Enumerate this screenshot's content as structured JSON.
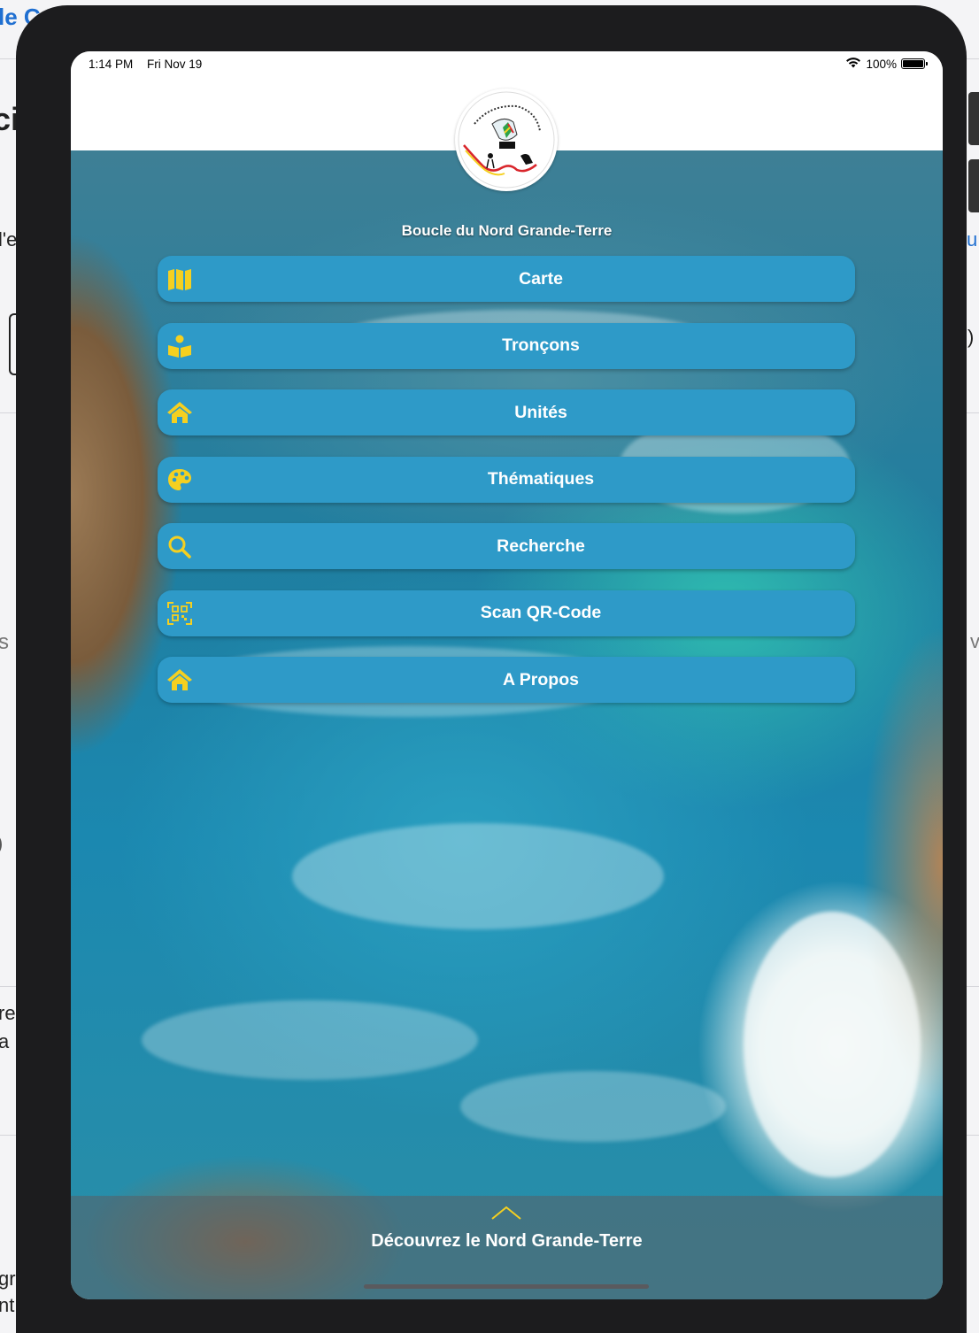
{
  "status_bar": {
    "time": "1:14 PM",
    "date": "Fri Nov 19",
    "battery": "100%"
  },
  "background_fragments": {
    "top_link": "le C",
    "frag_ci": "ci",
    "frag_le": "l'e",
    "frag_s": "s",
    "frag_paren": ")",
    "frag_o": ") ",
    "frag_re": "re",
    "frag_a": "a",
    "frag_gr": "gr",
    "frag_nt": "nt",
    "frag_u": "u",
    "frag_close": ")",
    "frag_v": "v"
  },
  "app": {
    "logo_alt": "Boucle du Nord Grande-Terre logo",
    "title": "Boucle du Nord Grande-Terre",
    "menu": [
      {
        "label": "Carte",
        "icon": "map-icon"
      },
      {
        "label": "Tronçons",
        "icon": "reader-icon"
      },
      {
        "label": "Unités",
        "icon": "home-icon"
      },
      {
        "label": "Thématiques",
        "icon": "palette-icon"
      },
      {
        "label": "Recherche",
        "icon": "search-icon"
      },
      {
        "label": "Scan QR-Code",
        "icon": "qr-code-icon"
      },
      {
        "label": "A Propos",
        "icon": "home-icon"
      }
    ],
    "bottom": {
      "label": "Découvrez le Nord Grande-Terre"
    }
  },
  "colors": {
    "button_bg": "#2e9ac8",
    "icon_yellow": "#f5d020",
    "device_frame": "#1c1c1e"
  }
}
